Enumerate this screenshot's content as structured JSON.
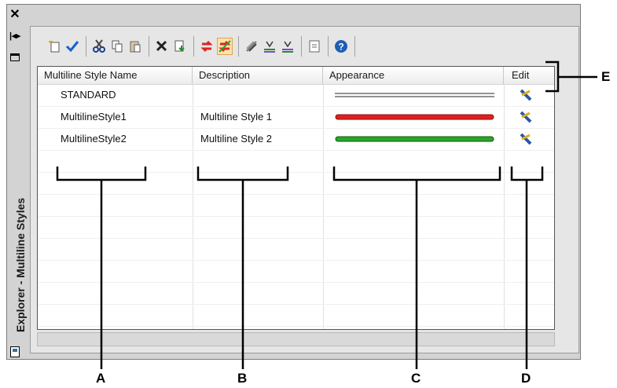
{
  "panel_title": "Explorer - Multiline Styles",
  "columns": [
    {
      "label": "Multiline Style Name"
    },
    {
      "label": "Description"
    },
    {
      "label": "Appearance"
    },
    {
      "label": "Edit"
    }
  ],
  "rows": [
    {
      "name": "STANDARD",
      "description": "",
      "appearance": "double-gray-line",
      "line_color": "#6e6e6e"
    },
    {
      "name": "MultilineStyle1",
      "description": "Multiline Style 1",
      "appearance": "red-line",
      "line_color": "#e02020"
    },
    {
      "name": "MultilineStyle2",
      "description": "Multiline Style 2",
      "appearance": "green-line",
      "line_color": "#2aa52a"
    }
  ],
  "toolbar_icons": [
    "new-style-icon",
    "set-current-icon",
    "cut-icon",
    "copy-icon",
    "paste-icon",
    "delete-icon",
    "import-icon",
    "purge-icon",
    "purge-all-icon",
    "show-all-icon",
    "line-tool-icon",
    "line-tool-2-icon",
    "properties-icon",
    "help-icon"
  ],
  "callouts": {
    "a": "A",
    "b": "B",
    "c": "C",
    "d": "D",
    "e": "E"
  },
  "colors": {
    "frame": "#d3d3d3",
    "brace": "#000000",
    "help": "#1e5fb4",
    "check": "#1b5fc9",
    "purge_red": "#e02424"
  }
}
